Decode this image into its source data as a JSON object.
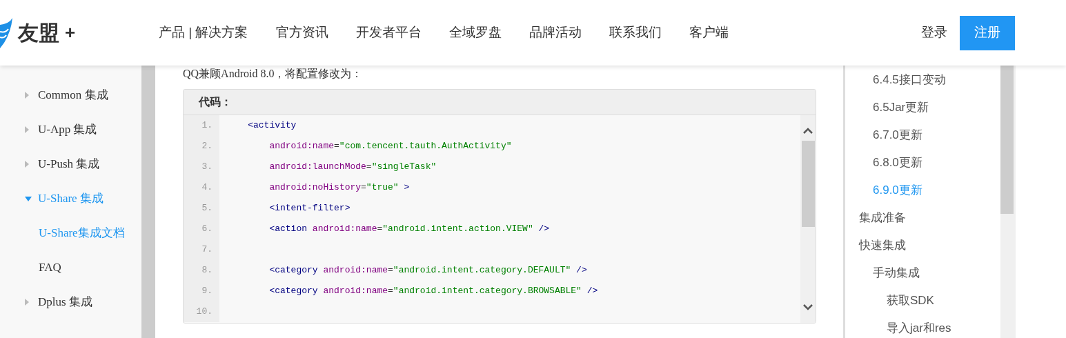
{
  "header": {
    "logo_text": "友盟",
    "logo_plus": "+",
    "nav": [
      {
        "label": "产品 | 解决方案",
        "selected": false
      },
      {
        "label": "官方资讯",
        "selected": false
      },
      {
        "label": "开发者平台",
        "selected": false
      },
      {
        "label": "全域罗盘",
        "selected": false
      },
      {
        "label": "品牌活动",
        "selected": false
      },
      {
        "label": "联系我们",
        "selected": false
      },
      {
        "label": "客户端",
        "selected": false
      }
    ],
    "login": "登录",
    "register": "注册"
  },
  "sidebar": {
    "items": [
      {
        "label": "Common 集成",
        "expanded": false,
        "selected": false
      },
      {
        "label": "U-App 集成",
        "expanded": false,
        "selected": false
      },
      {
        "label": "U-Push 集成",
        "expanded": false,
        "selected": false
      },
      {
        "label": "U-Share 集成",
        "expanded": true,
        "selected": true,
        "children": [
          {
            "label": "U-Share集成文档",
            "selected": true
          },
          {
            "label": "FAQ",
            "selected": false
          }
        ]
      },
      {
        "label": "Dplus 集成",
        "expanded": false,
        "selected": false
      }
    ]
  },
  "content": {
    "paragraph": "QQ兼顾Android 8.0，将配置修改为：",
    "code": {
      "title": "代码：",
      "lines": [
        {
          "number": "1.",
          "tokens": [
            {
              "kind": "tag",
              "text": "    <activity"
            }
          ]
        },
        {
          "number": "2.",
          "tokens": [
            {
              "kind": "attr",
              "text": "        android:name"
            },
            {
              "kind": "plain",
              "text": "="
            },
            {
              "kind": "value",
              "text": "\"com.tencent.tauth.AuthActivity\""
            }
          ]
        },
        {
          "number": "3.",
          "tokens": [
            {
              "kind": "attr",
              "text": "        android:launchMode"
            },
            {
              "kind": "plain",
              "text": "="
            },
            {
              "kind": "value",
              "text": "\"singleTask\""
            }
          ]
        },
        {
          "number": "4.",
          "tokens": [
            {
              "kind": "attr",
              "text": "        android:noHistory"
            },
            {
              "kind": "plain",
              "text": "="
            },
            {
              "kind": "value",
              "text": "\"true\""
            },
            {
              "kind": "tag",
              "text": " >"
            }
          ]
        },
        {
          "number": "5.",
          "tokens": [
            {
              "kind": "tag",
              "text": "        <intent-filter>"
            }
          ]
        },
        {
          "number": "6.",
          "tokens": [
            {
              "kind": "tag",
              "text": "        <action"
            },
            {
              "kind": "attr",
              "text": " android:name"
            },
            {
              "kind": "plain",
              "text": "="
            },
            {
              "kind": "value",
              "text": "\"android.intent.action.VIEW\""
            },
            {
              "kind": "tag",
              "text": " />"
            }
          ]
        },
        {
          "number": "7."
        },
        {
          "number": "8.",
          "tokens": [
            {
              "kind": "tag",
              "text": "        <category"
            },
            {
              "kind": "attr",
              "text": " android:name"
            },
            {
              "kind": "plain",
              "text": "="
            },
            {
              "kind": "value",
              "text": "\"android.intent.category.DEFAULT\""
            },
            {
              "kind": "tag",
              "text": " />"
            }
          ]
        },
        {
          "number": "9.",
          "tokens": [
            {
              "kind": "tag",
              "text": "        <category"
            },
            {
              "kind": "attr",
              "text": " android:name"
            },
            {
              "kind": "plain",
              "text": "="
            },
            {
              "kind": "value",
              "text": "\"android.intent.category.BROWSABLE\""
            },
            {
              "kind": "tag",
              "text": " />"
            }
          ]
        },
        {
          "number": "10."
        }
      ]
    }
  },
  "toc": {
    "items": [
      {
        "children": [
          {
            "label": "6.4.5接口变动",
            "selected": false
          },
          {
            "label": "6.5Jar更新",
            "selected": false
          },
          {
            "label": "6.7.0更新",
            "selected": false
          },
          {
            "label": "6.8.0更新",
            "selected": false
          },
          {
            "label": "6.9.0更新",
            "selected": true
          }
        ]
      },
      {
        "label": "集成准备",
        "selected": false
      },
      {
        "label": "快速集成",
        "selected": false,
        "children": [
          {
            "label": "手动集成",
            "selected": false,
            "children": [
              {
                "label": "获取SDK",
                "selected": false
              },
              {
                "label": "导入jar和res",
                "selected": false
              }
            ]
          }
        ]
      }
    ]
  }
}
